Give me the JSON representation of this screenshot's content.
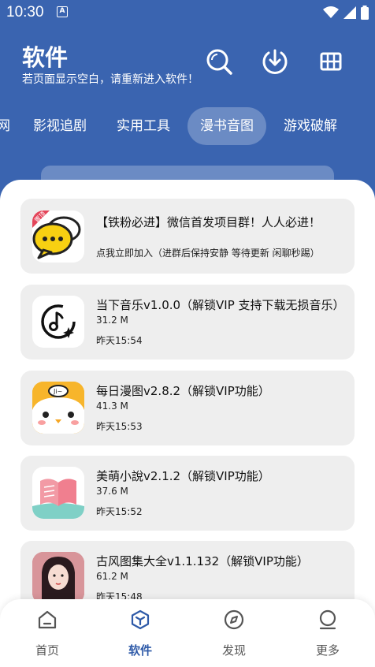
{
  "status": {
    "time": "10:30",
    "a_badge": "A"
  },
  "header": {
    "title": "软件",
    "subtitle": "若页面显示空白，请重新进入软件！"
  },
  "tabs": [
    "网",
    "影视追剧",
    "实用工具",
    "漫书音图",
    "游戏破解"
  ],
  "active_tab_index": 3,
  "apps": [
    {
      "title": "【铁粉必进】微信首发项目群！人人必进！",
      "subtitle": "点我立即加入（进群后保持安静 等待更新 闲聊秒踢）",
      "badge": "置顶",
      "icon": "chat-bubble-icon"
    },
    {
      "title": "当下音乐v1.0.0（解锁VIP 支持下载无损音乐）",
      "size": "31.2 M",
      "time": "昨天15:54",
      "icon": "music-note-icon"
    },
    {
      "title": "每日漫图v2.8.2（解锁VIP功能）",
      "size": "41.3 M",
      "time": "昨天15:53",
      "icon": "cartoon-face-icon"
    },
    {
      "title": "美萌小說v2.1.2（解锁VIP功能）",
      "size": "37.6 M",
      "time": "昨天15:52",
      "icon": "open-book-icon"
    },
    {
      "title": "古风图集大全v1.1.132（解锁VIP功能）",
      "size": "61.2 M",
      "time": "昨天15:48",
      "icon": "portrait-icon"
    }
  ],
  "nav": [
    {
      "label": "首页",
      "icon": "home-icon"
    },
    {
      "label": "软件",
      "icon": "cube-icon"
    },
    {
      "label": "发现",
      "icon": "compass-icon"
    },
    {
      "label": "更多",
      "icon": "profile-icon"
    }
  ],
  "active_nav_index": 1,
  "colors": {
    "primary": "#3a64b0",
    "card_bg": "#eeeeee",
    "nav_active": "#2e5aa8"
  }
}
